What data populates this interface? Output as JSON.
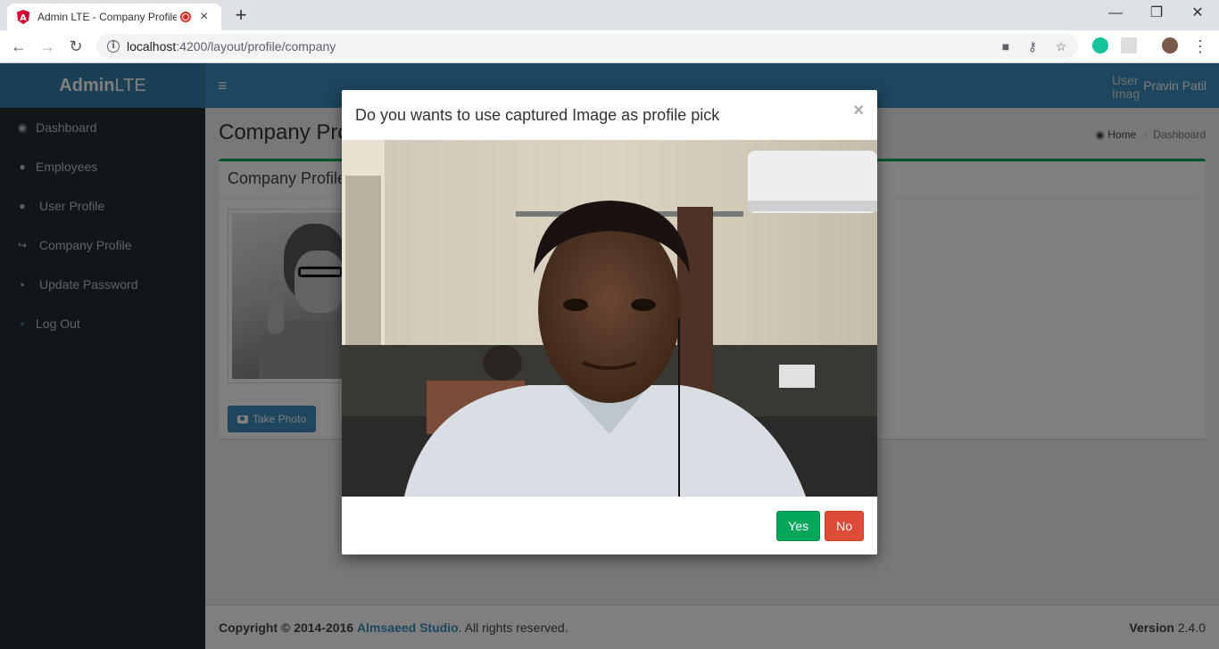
{
  "browser": {
    "tab_title": "Admin LTE - Company Profile",
    "tab_close": "×",
    "new_tab": "+",
    "url_host": "localhost",
    "url_path": ":4200/layout/profile/company",
    "window_controls": {
      "minimize": "—",
      "restore": "❐",
      "close": "✕"
    }
  },
  "header": {
    "logo_bold": "Admin",
    "logo_light": "LTE",
    "user_image_alt": "User Image",
    "user_name": "Pravin Patil"
  },
  "sidebar": {
    "items": [
      {
        "label": "Dashboard",
        "icon": "dashboard-icon"
      },
      {
        "label": "Employees",
        "icon": "user-icon"
      },
      {
        "label": "User Profile",
        "icon": "user-icon"
      },
      {
        "label": "Company Profile",
        "icon": "share-icon"
      },
      {
        "label": "Update Password",
        "icon": "lock-icon"
      },
      {
        "label": "Log Out",
        "icon": "lock-icon"
      }
    ]
  },
  "main": {
    "page_title": "Company Profile",
    "breadcrumb": {
      "home": "Home",
      "current": "Dashboard"
    },
    "box_title": "Company Profile",
    "take_photo_label": "Take Photo"
  },
  "footer": {
    "copyright": "Copyright © 2014-2016",
    "company": "Almsaeed Studio",
    "rights": ". All rights reserved.",
    "version_label": "Version",
    "version_number": "2.4.0"
  },
  "modal": {
    "title": "Do you wants to use captured Image as profile pick",
    "close": "×",
    "yes_label": "Yes",
    "no_label": "No"
  },
  "colors": {
    "primary": "#3c8dbc",
    "success": "#00a65a",
    "danger": "#dd4b39",
    "sidebar_bg": "#222d32",
    "logo_bg": "#367fa9"
  }
}
